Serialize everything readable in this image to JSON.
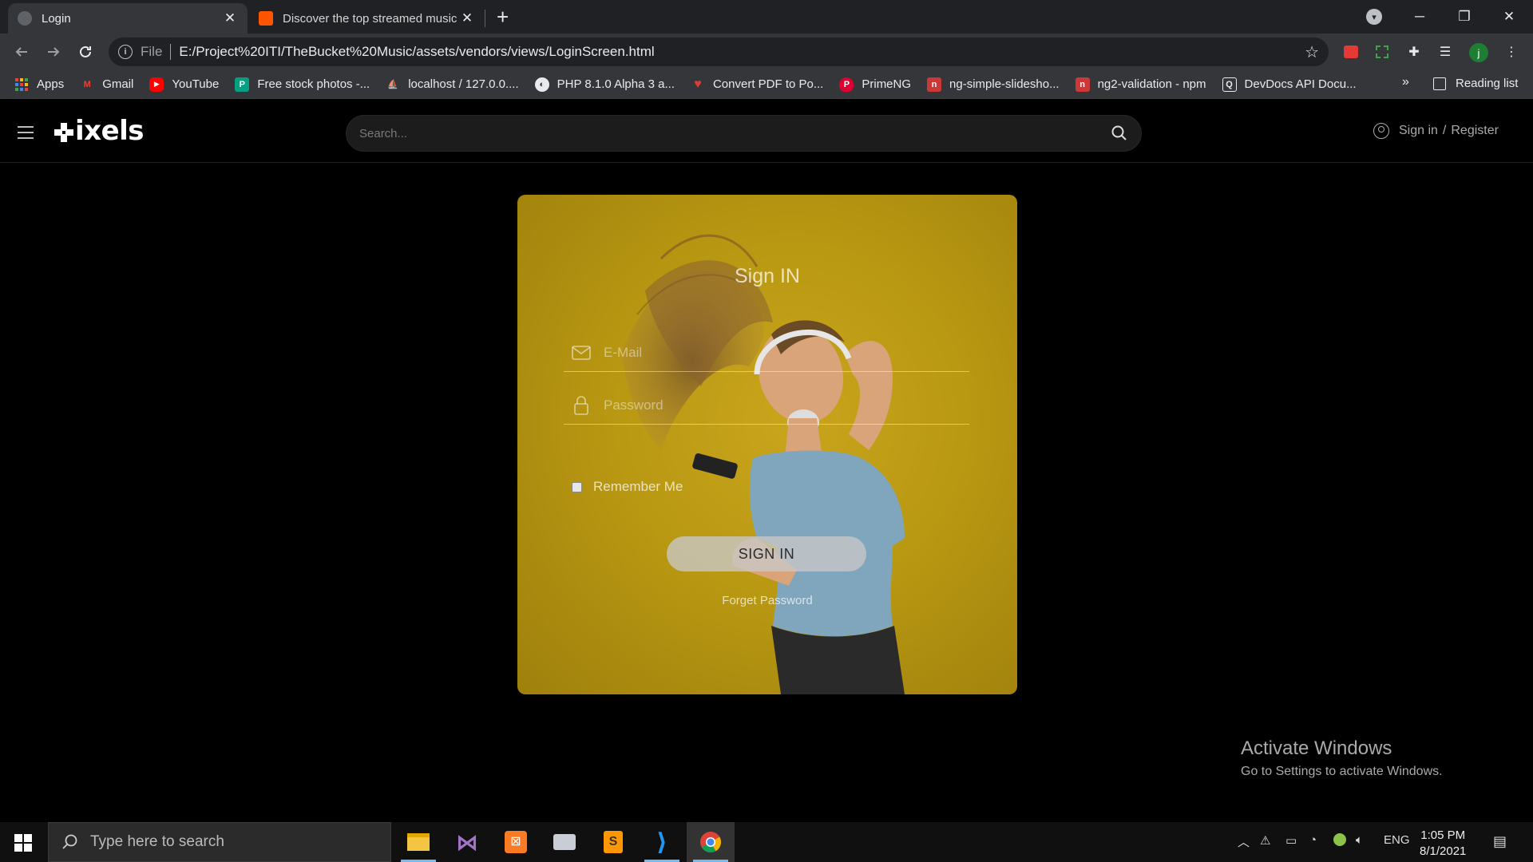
{
  "browser": {
    "tabs": [
      {
        "title": "Login",
        "active": true
      },
      {
        "title": "Discover the top streamed music",
        "active": false
      }
    ],
    "new_tab": "+",
    "window_controls": {
      "minimize": "─",
      "restore": "❐",
      "close": "✕"
    },
    "address": {
      "protocol_label": "File",
      "url": "E:/Project%20ITI/TheBucket%20Music/assets/vendors/views/LoginScreen.html"
    },
    "profile_initial": "j",
    "bookmarks": [
      {
        "label": "Apps",
        "icon": "apps-grid-icon"
      },
      {
        "label": "Gmail",
        "icon": "gmail-icon"
      },
      {
        "label": "YouTube",
        "icon": "youtube-icon"
      },
      {
        "label": "Free stock photos -...",
        "icon": "pexels-icon"
      },
      {
        "label": "localhost / 127.0.0....",
        "icon": "phpmyadmin-icon"
      },
      {
        "label": "PHP 8.1.0 Alpha 3 a...",
        "icon": "globe-icon"
      },
      {
        "label": "Convert PDF to Po...",
        "icon": "heart-icon"
      },
      {
        "label": "PrimeNG",
        "icon": "primeng-icon"
      },
      {
        "label": "ng-simple-slidesho...",
        "icon": "npm-icon"
      },
      {
        "label": "ng2-validation - npm",
        "icon": "npm-icon"
      },
      {
        "label": "DevDocs API Docu...",
        "icon": "devdocs-icon"
      }
    ],
    "bookmarks_more": "»",
    "reading_list": "Reading list"
  },
  "site": {
    "logo": "ixels",
    "search_placeholder": "Search...",
    "sign_in": "Sign in",
    "separator": "/",
    "register": "Register"
  },
  "login": {
    "heading": "Sign IN",
    "email_placeholder": "E-Mail",
    "password_placeholder": "Password",
    "remember_me": "Remember Me",
    "submit": "SIGN IN",
    "forget_password": "Forget Password"
  },
  "watermark": {
    "title": "Activate Windows",
    "subtitle": "Go to Settings to activate Windows."
  },
  "taskbar": {
    "search_placeholder": "Type here to search",
    "language": "ENG",
    "time": "1:05 PM",
    "date": "8/1/2021"
  },
  "colors": {
    "card_gold": "#b99812",
    "chrome_dark": "#202124",
    "toolbar": "#35363a"
  }
}
